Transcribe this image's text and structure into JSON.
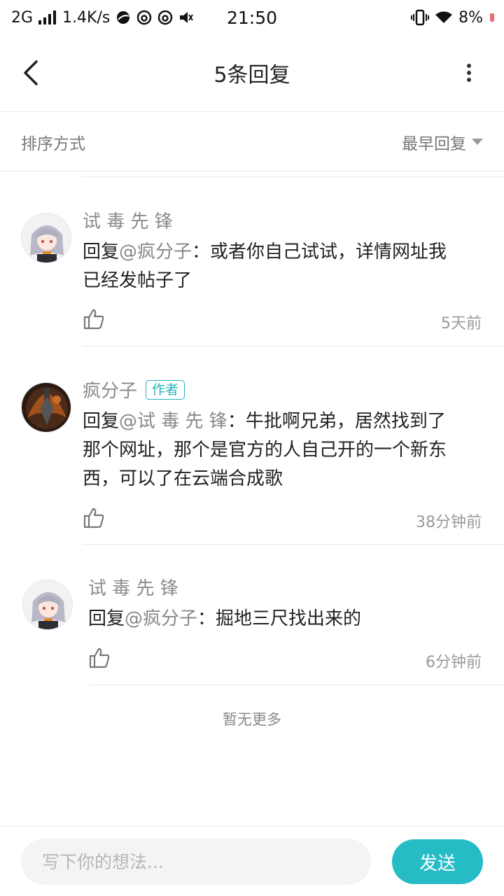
{
  "status_bar": {
    "network": "2G",
    "speed": "1.4K/s",
    "time": "21:50",
    "battery": "8%"
  },
  "header": {
    "title": "5条回复"
  },
  "sort": {
    "label": "排序方式",
    "selected": "最早回复"
  },
  "replies": [
    {
      "username": "试 毒 先 锋",
      "badge": "",
      "prefix": "回复",
      "mention": "@疯分子",
      "text_line1": "：或者你自己试试，详情网址我",
      "text_line2": "已经发帖子了",
      "text_line3": "",
      "time": "5天前"
    },
    {
      "username": "疯分子",
      "badge": "作者",
      "prefix": "回复",
      "mention": "@试 毒 先 锋",
      "text_line1": "：牛批啊兄弟，居然找到了",
      "text_line2": "那个网址，那个是官方的人自己开的一个新东",
      "text_line3": "西，可以了在云端合成歌",
      "time": "38分钟前"
    },
    {
      "username": "试 毒 先 锋",
      "badge": "",
      "prefix": "回复",
      "mention": "@疯分子",
      "text_line1": "：掘地三尺找出来的",
      "text_line2": "",
      "text_line3": "",
      "time": "6分钟前"
    }
  ],
  "footer_note": "暂无更多",
  "composer": {
    "placeholder": "写下你的想法...",
    "send_label": "发送"
  },
  "colors": {
    "accent": "#26bcc6",
    "badge": "#23b3be",
    "battery_low": "#f16a7a"
  },
  "icons": [
    "back-arrow-icon",
    "more-vertical-icon",
    "caret-down-icon",
    "thumb-up-icon",
    "signal-icon",
    "wifi-icon",
    "vibrate-icon",
    "mute-icon"
  ]
}
